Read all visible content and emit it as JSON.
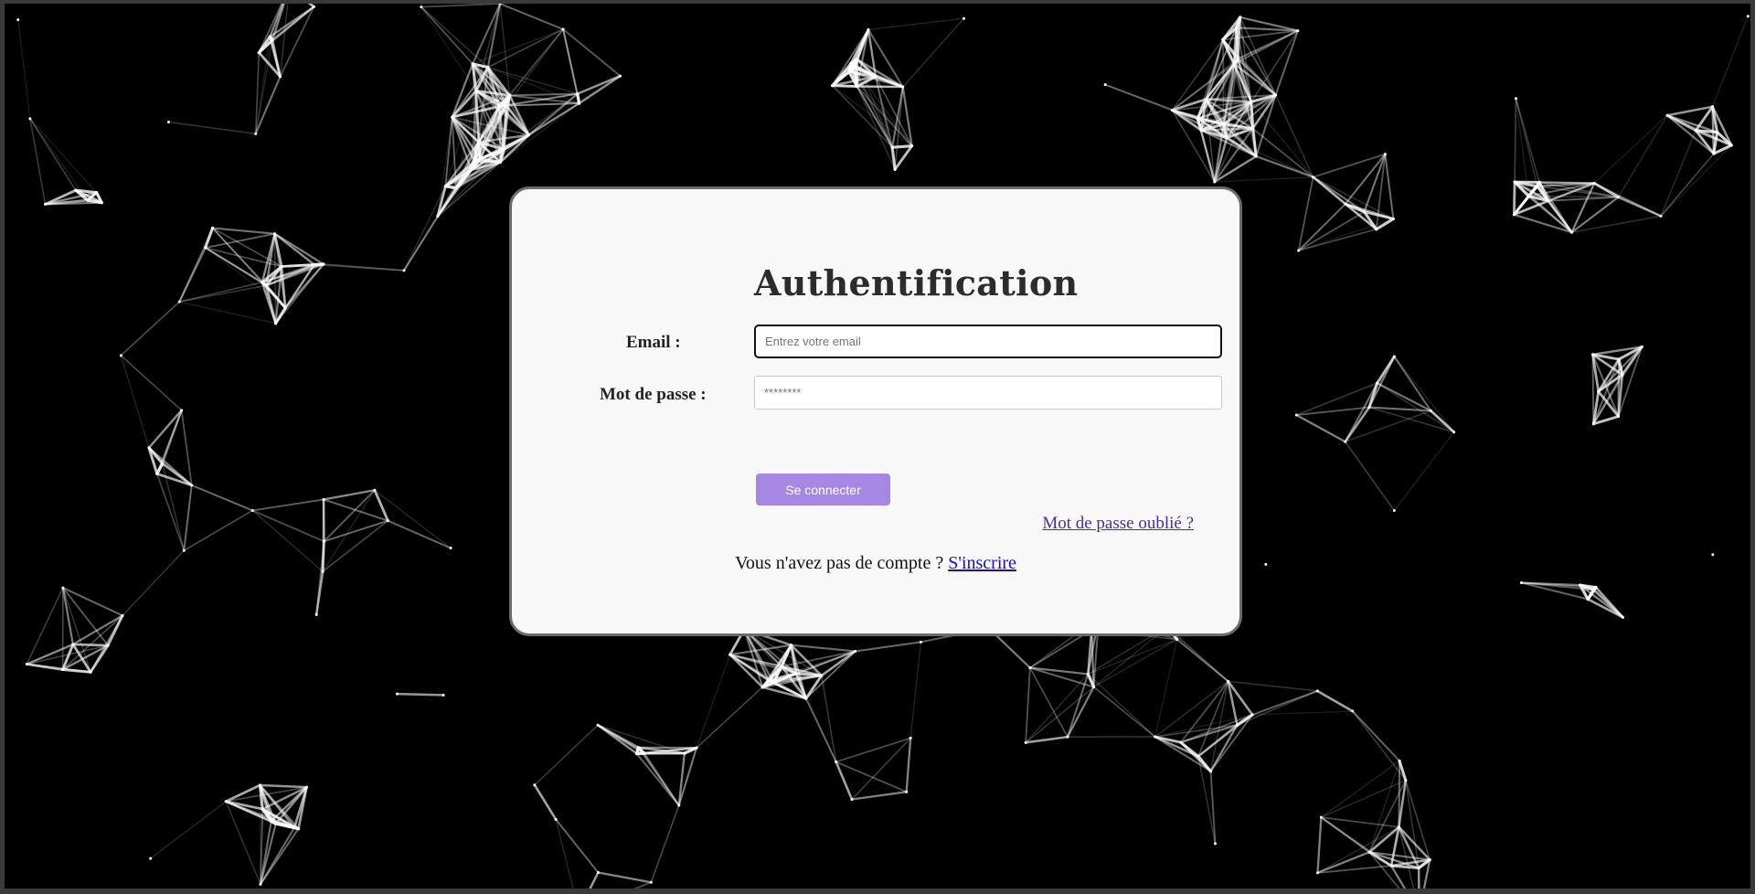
{
  "login": {
    "title": "Authentification",
    "email_label": "Email :",
    "email_placeholder": "Entrez votre email",
    "password_label": "Mot de passe :",
    "password_placeholder": "********",
    "submit_label": "Se connecter",
    "forgot_link": "Mot de passe oublié ?",
    "signup_prompt": "Vous n'avez pas de compte ?",
    "signup_link": "S'inscrire"
  },
  "colors": {
    "background": "#000000",
    "card": "#f8f8f8",
    "button": "#a688e4",
    "forgot_link": "#4b2c9c",
    "signup_link": "#1a0dcc"
  }
}
